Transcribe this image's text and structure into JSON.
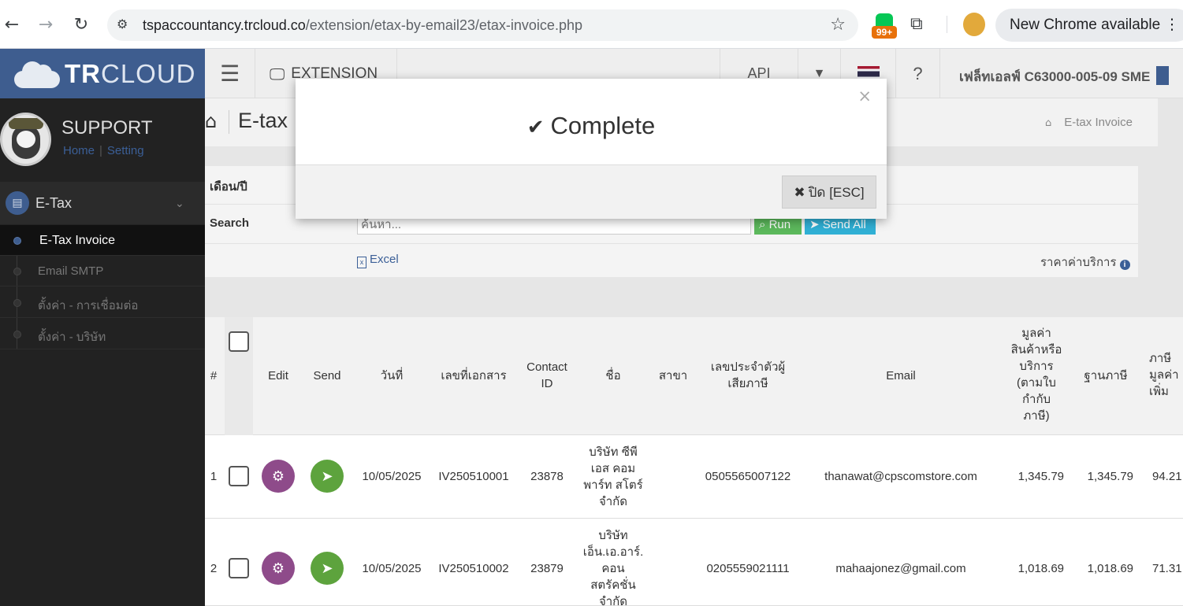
{
  "browser": {
    "url_host": "tspaccountancy.trcloud.co",
    "url_path": "/extension/etax-by-email23/etax-invoice.php",
    "extension_badge": "99+",
    "new_chrome_label": "New Chrome available",
    "menu_glyph": "⋮"
  },
  "app": {
    "logo_tr": "TR",
    "logo_cloud": "CLOUD",
    "extension_label": "EXTENSION",
    "api_label": "API",
    "company": "เฟล็ทเอลฟ์ C63000-005-09 SME"
  },
  "sidebar": {
    "user_name": "SUPPORT",
    "home_link": "Home",
    "link_sep": "|",
    "setting_link": "Setting",
    "section": "E-Tax",
    "items": [
      {
        "label": "E-Tax Invoice"
      },
      {
        "label": "Email SMTP"
      },
      {
        "label": "ตั้งค่า - การเชื่อมต่อ"
      },
      {
        "label": "ตั้งค่า - บริษัท"
      }
    ]
  },
  "page": {
    "title": "E-tax I",
    "breadcrumb": "E-tax Invoice"
  },
  "filter": {
    "month_label": "เดือน/ปี",
    "search_label": "Search",
    "search_placeholder": "ค้นหา...",
    "run_label": "Run",
    "send_all_label": "Send All",
    "excel_label": "Excel",
    "price_label": "ราคาค่าบริการ"
  },
  "table": {
    "headers": {
      "num": "#",
      "edit": "Edit",
      "send": "Send",
      "date": "วันที่",
      "doc_no": "เลขที่เอกสาร",
      "contact_id": "Contact ID",
      "name": "ชื่อ",
      "branch": "สาขา",
      "tax_id": "เลขประจำตัวผู้เสียภาษี",
      "email": "Email",
      "value": "มูลค่าสินค้าหรือบริการ (ตามใบกำกับภาษี)",
      "tax_base": "ฐานภาษี",
      "vat": "ภาษีมูลค่าเพิ่ม"
    },
    "rows": [
      {
        "num": "1",
        "date": "10/05/2025",
        "doc_no": "IV250510001",
        "contact_id": "23878",
        "name": "บริษัท ซีพี เอส คอม พาร์ท สโตร์ จำกัด",
        "branch": "",
        "tax_id": "0505565007122",
        "email": "thanawat@cpscomstore.com",
        "value": "1,345.79",
        "tax_base": "1,345.79",
        "vat": "94.21"
      },
      {
        "num": "2",
        "date": "10/05/2025",
        "doc_no": "IV250510002",
        "contact_id": "23879",
        "name": "บริษัท เอ็น.เอ.อาร์. คอน สตรัคชั่น จำกัด",
        "branch": "",
        "tax_id": "0205559021111",
        "email": "mahaajonez@gmail.com",
        "value": "1,018.69",
        "tax_base": "1,018.69",
        "vat": "71.31"
      }
    ]
  },
  "modal": {
    "title": "Complete",
    "close_button": "ปิด [ESC]",
    "close_x": "×"
  }
}
